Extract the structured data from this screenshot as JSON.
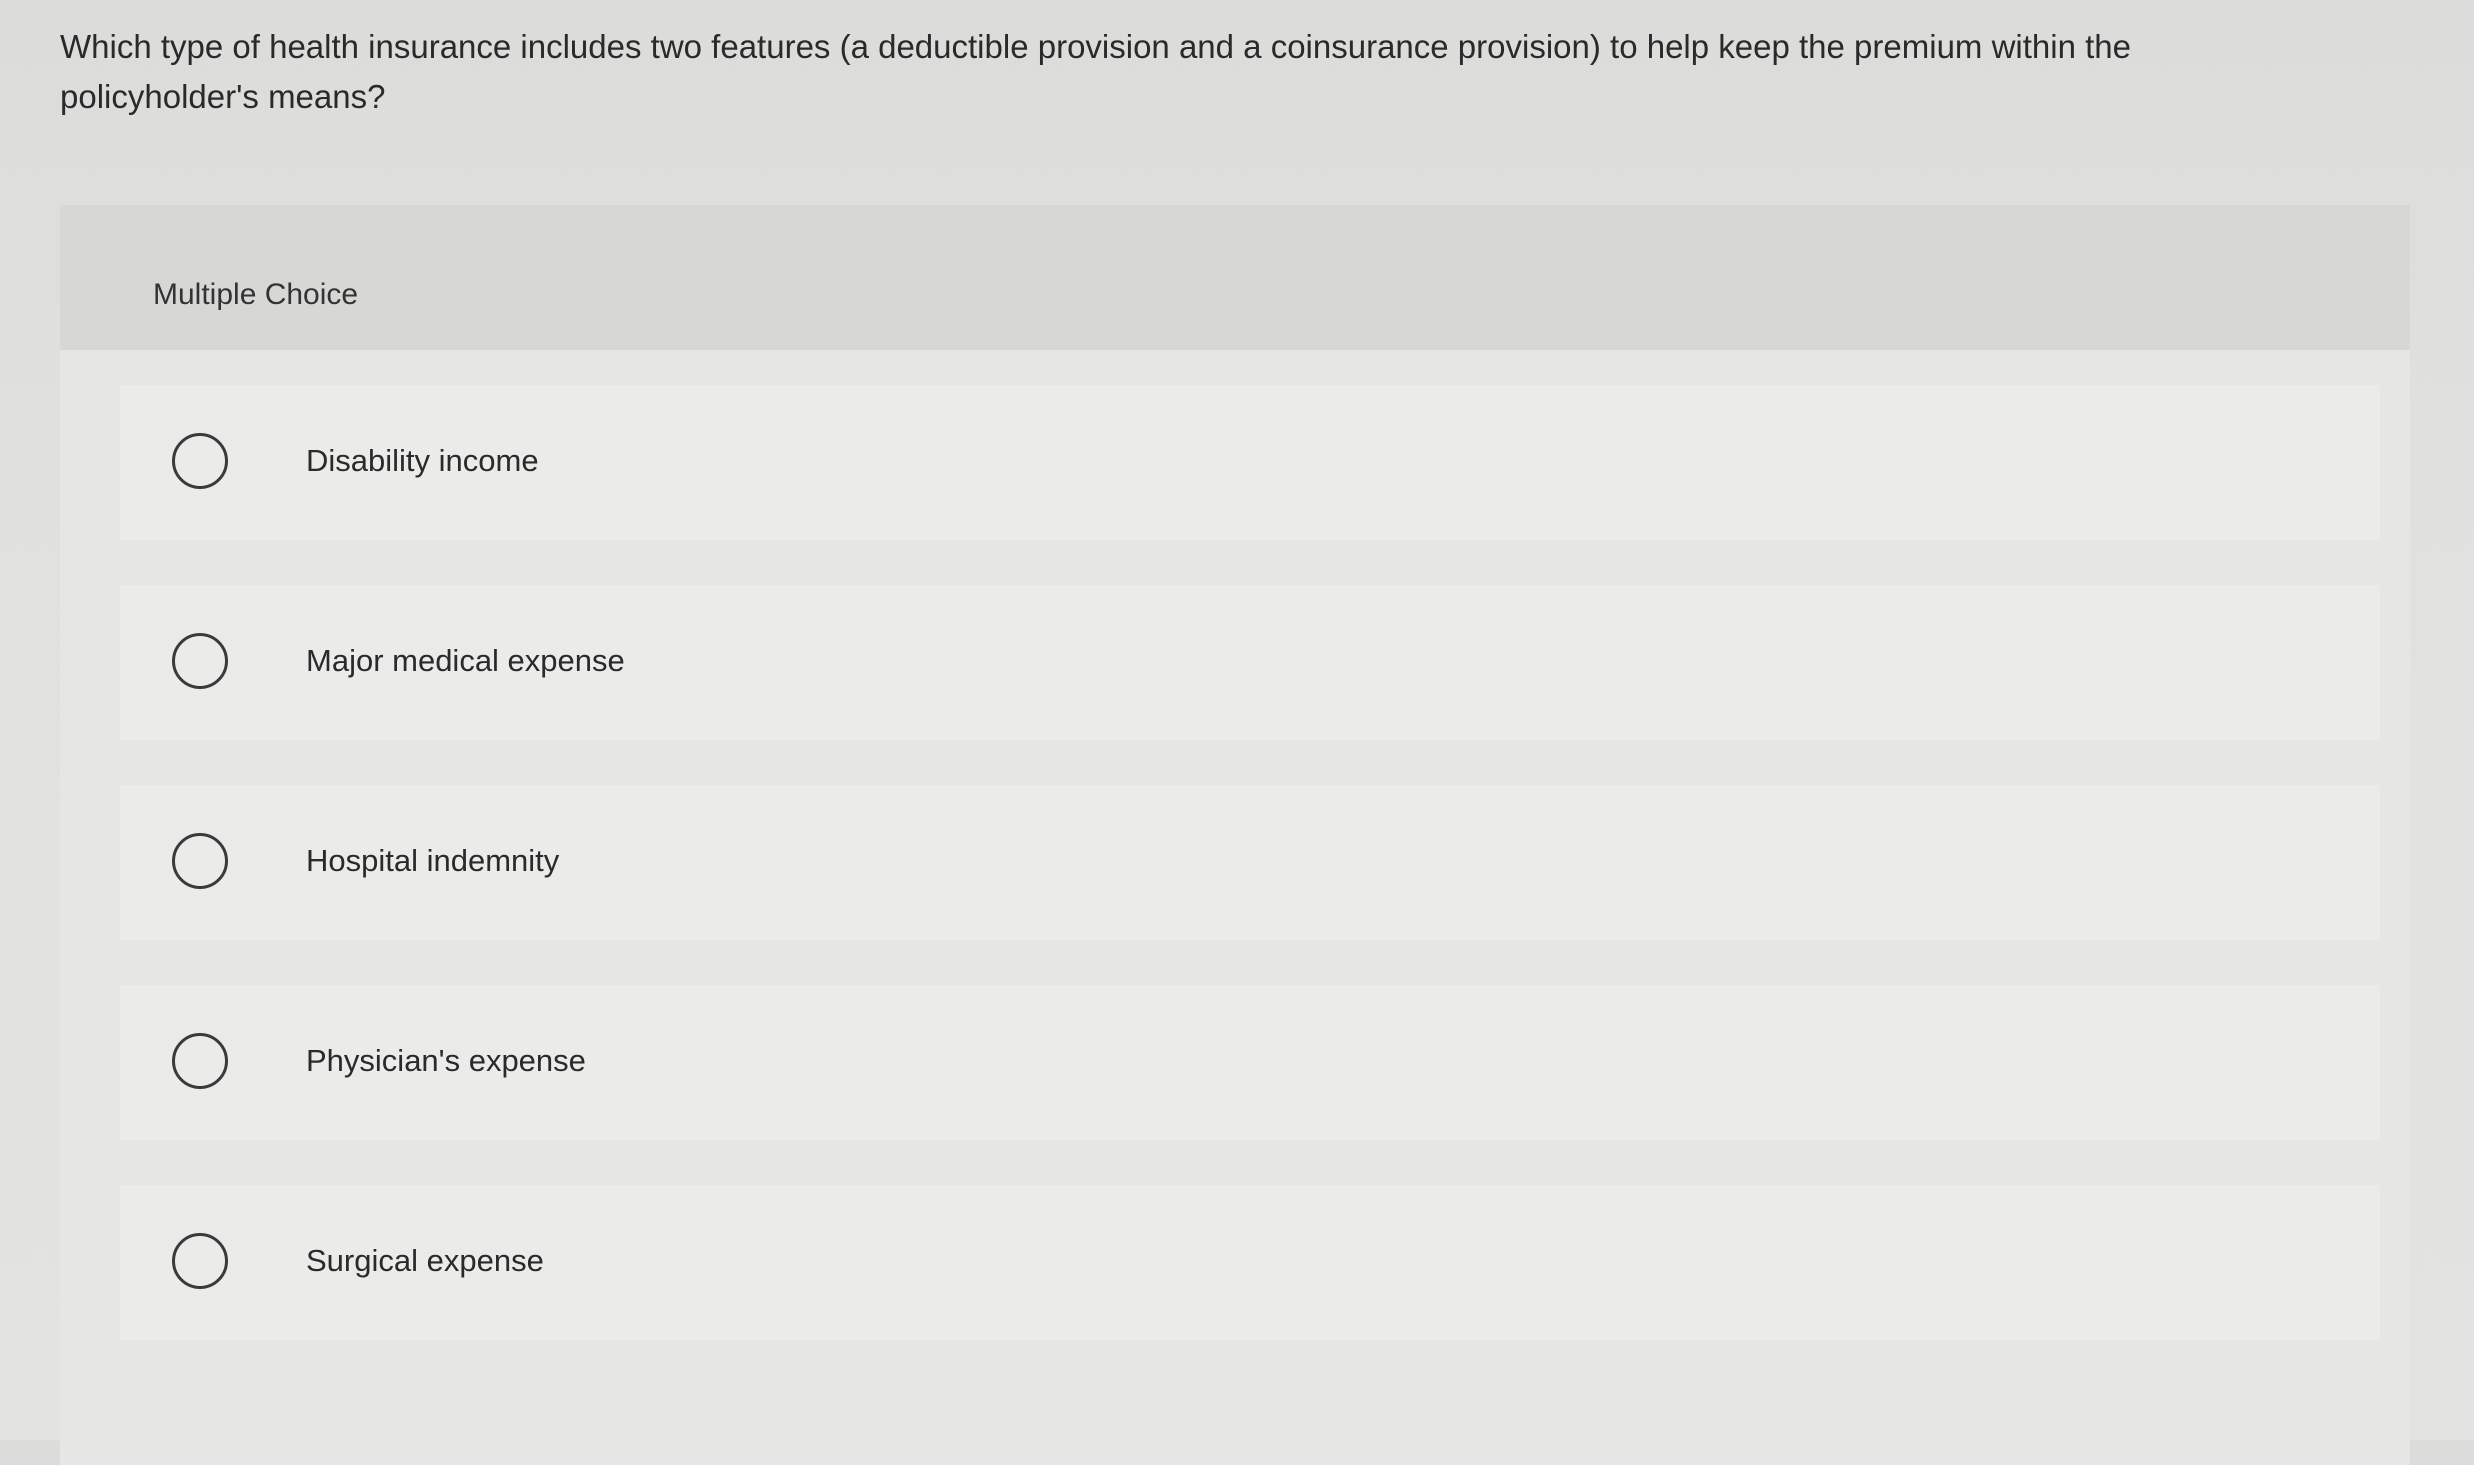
{
  "question": {
    "text": "Which type of health insurance includes two features (a deductible provision and a coinsurance provision) to help keep the premium within the policyholder's means?"
  },
  "card": {
    "header_label": "Multiple Choice"
  },
  "options": [
    {
      "label": "Disability income",
      "selected": false
    },
    {
      "label": "Major medical expense",
      "selected": false
    },
    {
      "label": "Hospital indemnity",
      "selected": false
    },
    {
      "label": "Physician's expense",
      "selected": false
    },
    {
      "label": "Surgical expense",
      "selected": false
    }
  ]
}
